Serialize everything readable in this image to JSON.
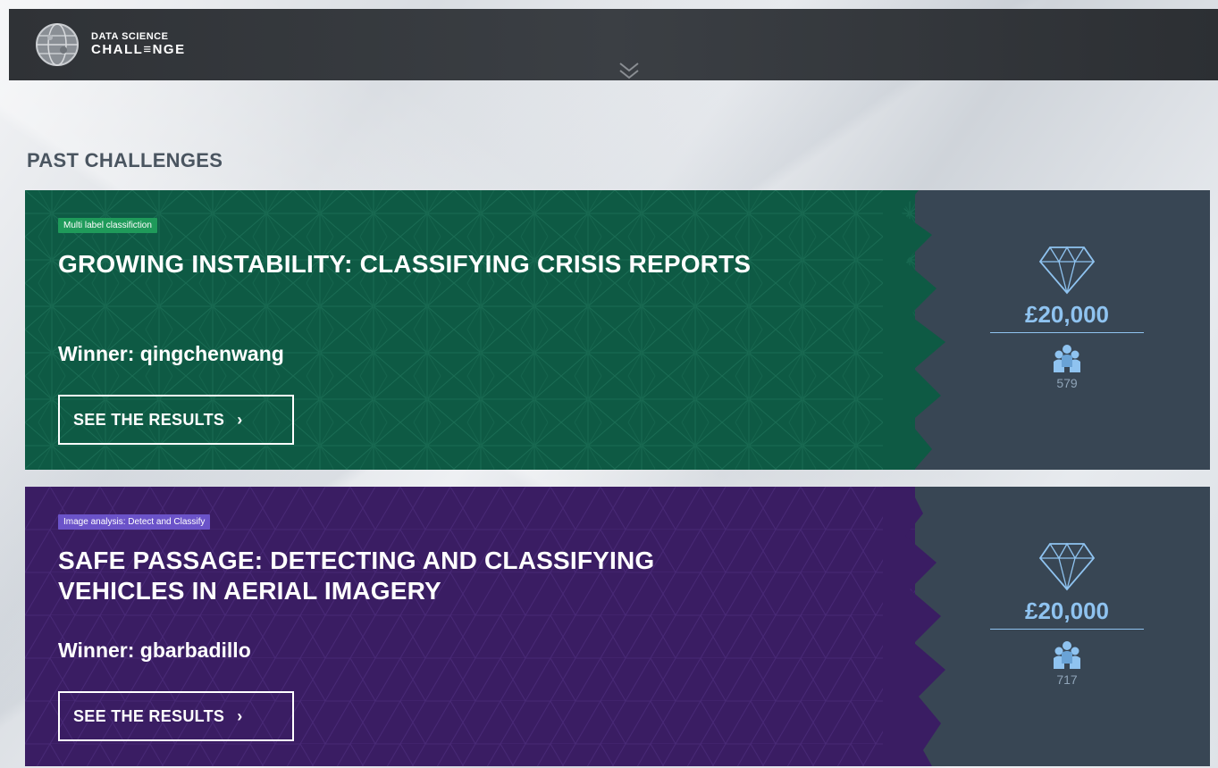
{
  "header": {
    "logo_line1": "DATA SCIENCE",
    "logo_line2": "CHALL≡NGE",
    "scroll_icon": "double-chevron-down-icon"
  },
  "section_title": "PAST CHALLENGES",
  "challenges": [
    {
      "tag": "Multi label classifiction",
      "title": "GROWING INSTABILITY: CLASSIFYING CRISIS REPORTS",
      "winner": "Winner: qingchenwang",
      "button_label": "SEE THE RESULTS",
      "prize": "£20,000",
      "participants": "579",
      "color": "#0e5a44",
      "tag_color": "#1f9a5a"
    },
    {
      "tag": "Image analysis: Detect and Classify",
      "title": "SAFE PASSAGE: DETECTING AND CLASSIFYING VEHICLES IN AERIAL IMAGERY",
      "winner": "Winner: gbarbadillo",
      "button_label": "SEE THE RESULTS",
      "prize": "£20,000",
      "participants": "717",
      "color": "#3a1d63",
      "tag_color": "#6b53c9"
    }
  ],
  "colors": {
    "prize_accent": "#8fc3f0",
    "stats_panel": "#384654",
    "header_bg": "#33373b"
  }
}
